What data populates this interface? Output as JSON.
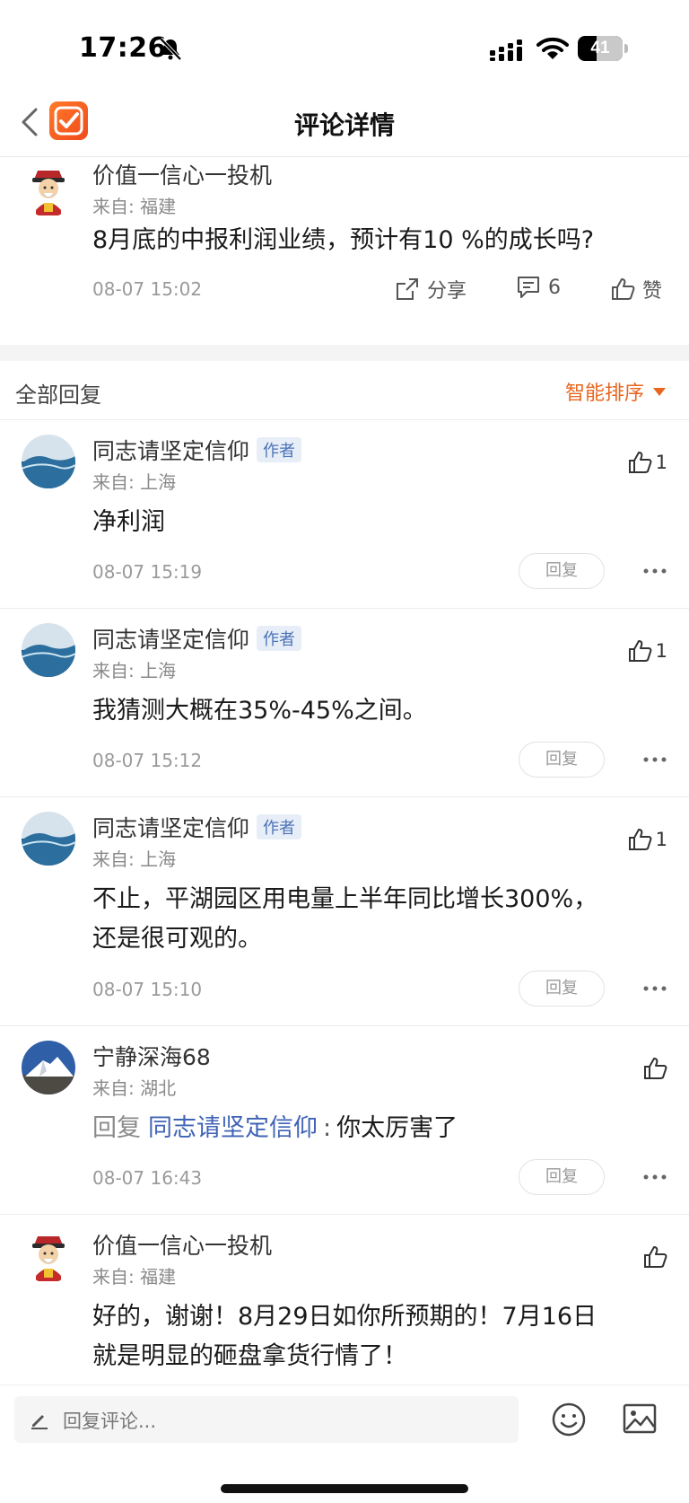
{
  "status_bar": {
    "time": "17:26",
    "battery": "41",
    "battery_level": 0.41
  },
  "nav": {
    "title": "评论详情"
  },
  "main_comment": {
    "user": "价值一信心一投机",
    "location": "来自: 福建",
    "text": "8月底的中报利润业绩，预计有10 %的成长吗?",
    "time": "08-07 15:02",
    "share_label": "分享",
    "comment_count": "6",
    "like_label": "赞"
  },
  "replies_header": {
    "title": "全部回复",
    "sort_label": "智能排序"
  },
  "replies": [
    {
      "user": "同志请坚定信仰",
      "badge": "作者",
      "location": "来自: 上海",
      "text": "净利润",
      "time": "08-07 15:19",
      "likes": "1",
      "reply_label": "回复"
    },
    {
      "user": "同志请坚定信仰",
      "badge": "作者",
      "location": "来自: 上海",
      "text": "我猜测大概在35%-45%之间。",
      "time": "08-07 15:12",
      "likes": "1",
      "reply_label": "回复"
    },
    {
      "user": "同志请坚定信仰",
      "badge": "作者",
      "location": "来自: 上海",
      "text_line1": "不止，平湖园区用电量上半年同比增长300%，",
      "text_line2": "还是很可观的。",
      "time": "08-07 15:10",
      "likes": "1",
      "reply_label": "回复"
    },
    {
      "user": "宁静深海68",
      "location": "来自: 湖北",
      "prefix": "回复",
      "target": "同志请坚定信仰",
      "sep": ":",
      "text": "你太厉害了",
      "time": "08-07 16:43",
      "reply_label": "回复"
    },
    {
      "user": "价值一信心一投机",
      "location": "来自: 福建",
      "text_line1": "好的，谢谢！8月29日如你所预期的！7月16日",
      "text_line2": "就是明显的砸盘拿货行情了！"
    }
  ],
  "bottom_bar": {
    "placeholder": "回复评论..."
  },
  "colors": {
    "accent": "#e8661f",
    "link": "#3f63b5",
    "badge_text": "#4b73b8",
    "badge_bg": "#e8eef8"
  }
}
